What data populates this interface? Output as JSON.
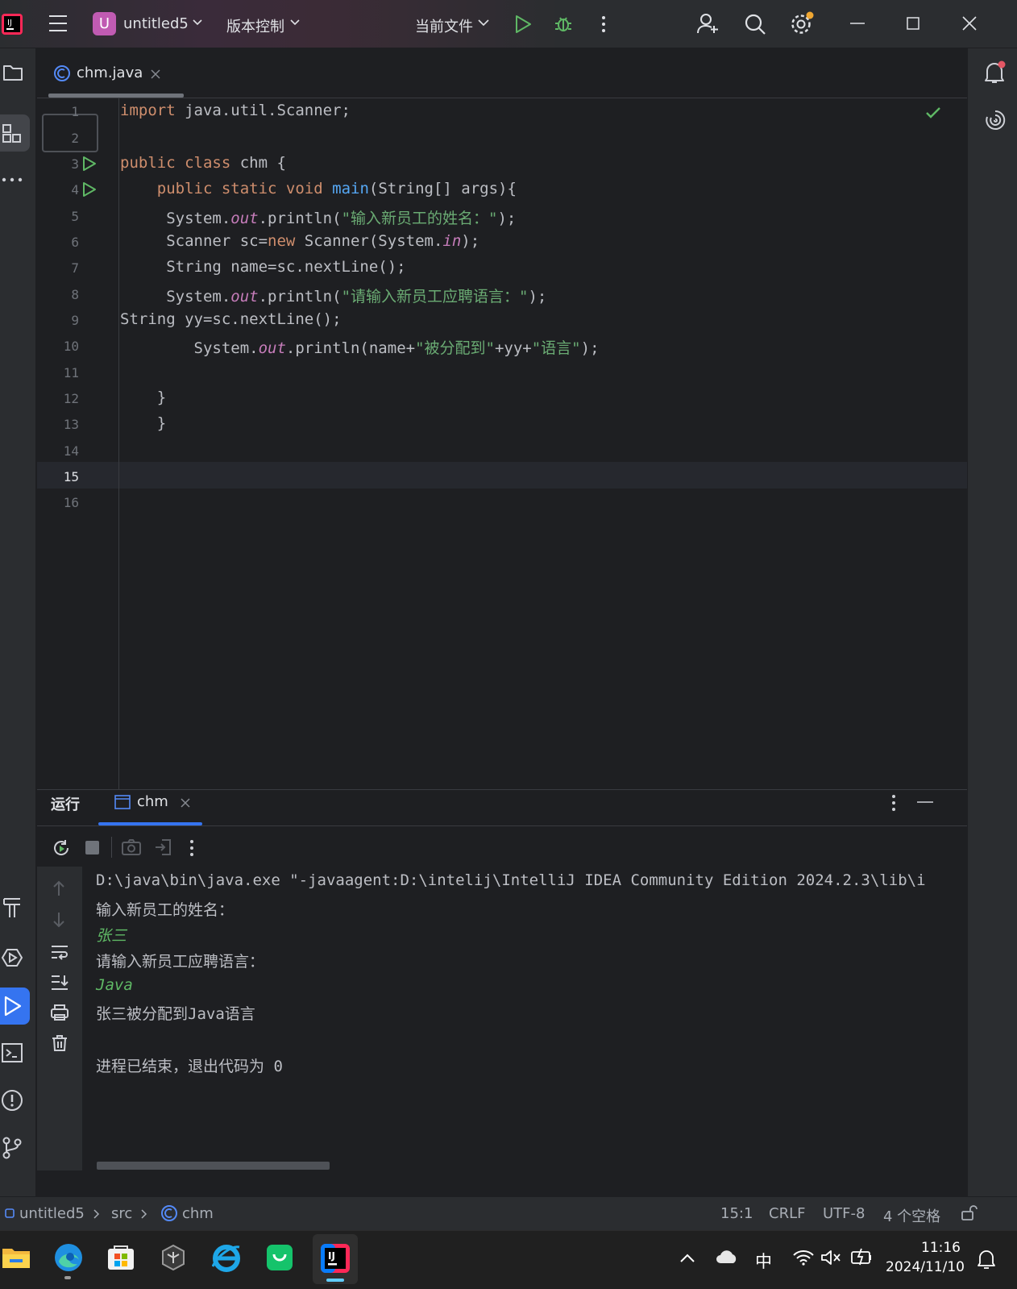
{
  "titlebar": {
    "project_letter": "U",
    "project_name": "untitled5",
    "vcs_menu": "版本控制",
    "run_config": "当前文件"
  },
  "tabs": [
    {
      "label": "chm.java"
    }
  ],
  "editor": {
    "line_numbers": [
      "1",
      "2",
      "3",
      "4",
      "5",
      "6",
      "7",
      "8",
      "9",
      "10",
      "11",
      "12",
      "13",
      "14",
      "15",
      "16"
    ],
    "current_line": "15"
  },
  "run_panel": {
    "title": "运行",
    "tab_label": "chm",
    "console": [
      "D:\\java\\bin\\java.exe \"-javaagent:D:\\intelij\\IntelliJ IDEA Community Edition 2024.2.3\\lib\\i",
      "输入新员工的姓名：",
      "张三",
      "请输入新员工应聘语言：",
      "Java",
      "张三被分配到Java语言",
      "",
      "进程已结束，退出代码为 0"
    ]
  },
  "statusbar": {
    "breadcrumb": [
      "untitled5",
      "src",
      "chm"
    ],
    "position": "15:1",
    "line_sep": "CRLF",
    "encoding": "UTF-8",
    "indent": "4 个空格"
  },
  "taskbar": {
    "ime": "中",
    "time": "11:16",
    "date": "2024/11/10"
  },
  "colors": {
    "keyword": "#cf8e6d",
    "function": "#56a8f5",
    "string": "#6aab73",
    "static_field": "#c77dbb",
    "run_green": "#5fb865",
    "accent": "#3574f0"
  }
}
